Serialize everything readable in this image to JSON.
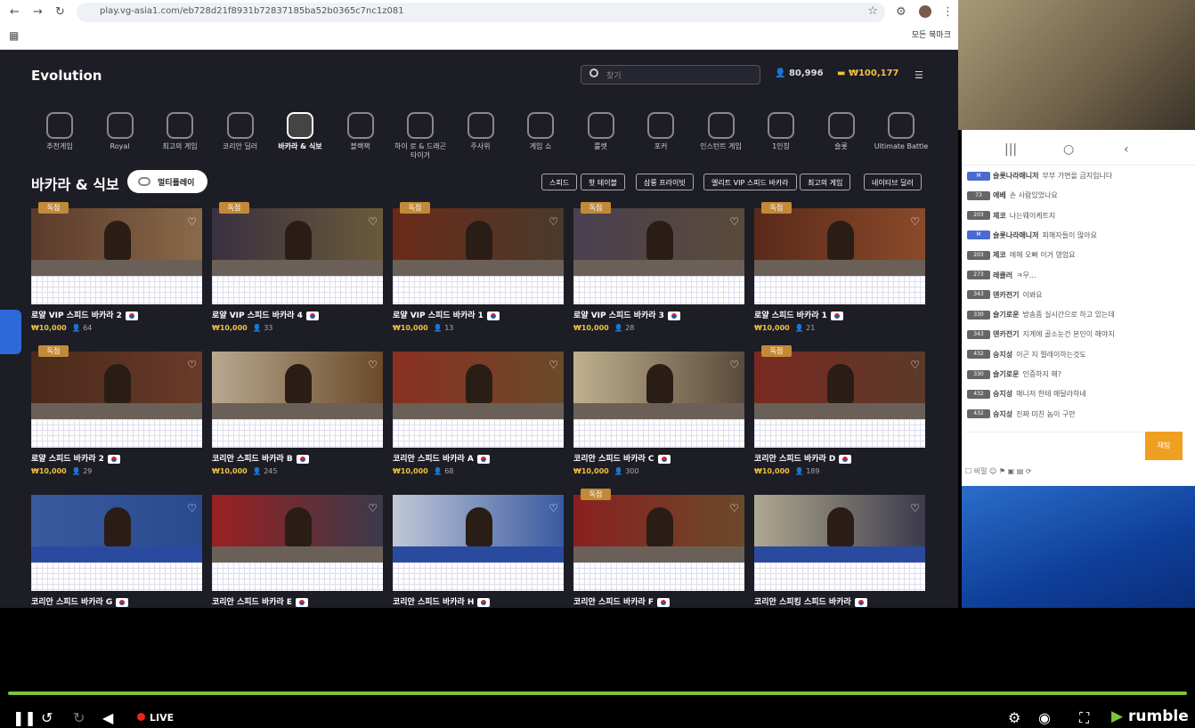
{
  "browser": {
    "url": "play.vg-asia1.com/eb728d21f8931b72837185ba52b0365c7nc1z081",
    "bookmarks": "모든 북마크"
  },
  "site": {
    "logo": "Evolution",
    "search_placeholder": "찾기",
    "players": "80,996",
    "balance": "₩100,177",
    "categories": [
      "추천게임",
      "Royal",
      "최고의 게임",
      "코리안 딜러",
      "바카라 & 식보",
      "블랙잭",
      "하이 로 & 드래곤 타이거",
      "주사위",
      "게임 쇼",
      "룰렛",
      "포커",
      "인스턴트 게임",
      "1인칭",
      "슬롯",
      "Ultimate Battle"
    ],
    "active_category": "바카라 & 식보",
    "section_title": "바카라 & 식보",
    "multiplay_label": "멀티플레이",
    "filters": [
      "스피드",
      "핫 테이블",
      "삼룡 프라이빗",
      "엘리트 VIP 스피드 바카라",
      "최고의 게임",
      "네이티브 딜러"
    ],
    "exclusive_label": "독점",
    "tiles": [
      {
        "name": "로얄 VIP 스피드 바카라 2",
        "bet": "₩10,000",
        "count": "64",
        "exclusive": true
      },
      {
        "name": "로얄 VIP 스피드 바카라 4",
        "bet": "₩10,000",
        "count": "33",
        "exclusive": true
      },
      {
        "name": "로얄 VIP 스피드 바카라 1",
        "bet": "₩10,000",
        "count": "13",
        "exclusive": true
      },
      {
        "name": "로얄 VIP 스피드 바카라 3",
        "bet": "₩10,000",
        "count": "28",
        "exclusive": true
      },
      {
        "name": "로얄 스피드 바카라 1",
        "bet": "₩10,000",
        "count": "21",
        "exclusive": true
      },
      {
        "name": "로얄 스피드 바카라 2",
        "bet": "₩10,000",
        "count": "29",
        "exclusive": true
      },
      {
        "name": "코리안 스피드 바카라 B",
        "bet": "₩10,000",
        "count": "245",
        "exclusive": false
      },
      {
        "name": "코리안 스피드 바카라 A",
        "bet": "₩10,000",
        "count": "68",
        "exclusive": false
      },
      {
        "name": "코리안 스피드 바카라 C",
        "bet": "₩10,000",
        "count": "300",
        "exclusive": false
      },
      {
        "name": "코리안 스피드 바카라 D",
        "bet": "₩10,000",
        "count": "189",
        "exclusive": true
      },
      {
        "name": "코리안 스피드 바카라 G",
        "bet": "",
        "count": "",
        "exclusive": false
      },
      {
        "name": "코리안 스피드 바카라 E",
        "bet": "",
        "count": "",
        "exclusive": false
      },
      {
        "name": "코리안 스피드 바카라 H",
        "bet": "",
        "count": "",
        "exclusive": false
      },
      {
        "name": "코리안 스피드 바카라 F",
        "bet": "",
        "count": "",
        "exclusive": true
      },
      {
        "name": "코리안 스피킹 스피드 바카라",
        "bet": "",
        "count": "",
        "exclusive": false
      }
    ]
  },
  "chat": {
    "messages": [
      {
        "nick": "슬롯나라매니저",
        "text": "부부 가면을 금지입니다",
        "lv": ""
      },
      {
        "nick": "에베",
        "text": "손 사람있었나요",
        "lv": "73"
      },
      {
        "nick": "제코",
        "text": "나는웨이케트지",
        "lv": "203"
      },
      {
        "nick": "슬롯나라매니저",
        "text": "피해자들이 많아요",
        "lv": ""
      },
      {
        "nick": "제코",
        "text": "에헤 오빠 이거 영업요",
        "lv": "203"
      },
      {
        "nick": "레클러",
        "text": "ㅋ무...",
        "lv": "273"
      },
      {
        "nick": "덴카전기",
        "text": "이봐요",
        "lv": "343"
      },
      {
        "nick": "슬기로운",
        "text": "방송좀 실시간으로 하고 있는데",
        "lv": "330"
      },
      {
        "nick": "덴카전기",
        "text": "지게에 골소눈건 본인이 해야지",
        "lv": "343"
      },
      {
        "nick": "승지성",
        "text": "이곤 지 찔레이하는것도",
        "lv": "432"
      },
      {
        "nick": "슬기로운",
        "text": "인증하지 해?",
        "lv": "330"
      },
      {
        "nick": "승지성",
        "text": "매니저 한테 매달라하네",
        "lv": "432"
      },
      {
        "nick": "승지성",
        "text": "진짜 미친 놈이 구만",
        "lv": "432"
      }
    ],
    "send_label": "채팅",
    "tools_label": "비밀"
  },
  "player": {
    "live_label": "LIVE",
    "brand": "rumble",
    "progress": 1.0,
    "accent": "#7cc43a"
  }
}
